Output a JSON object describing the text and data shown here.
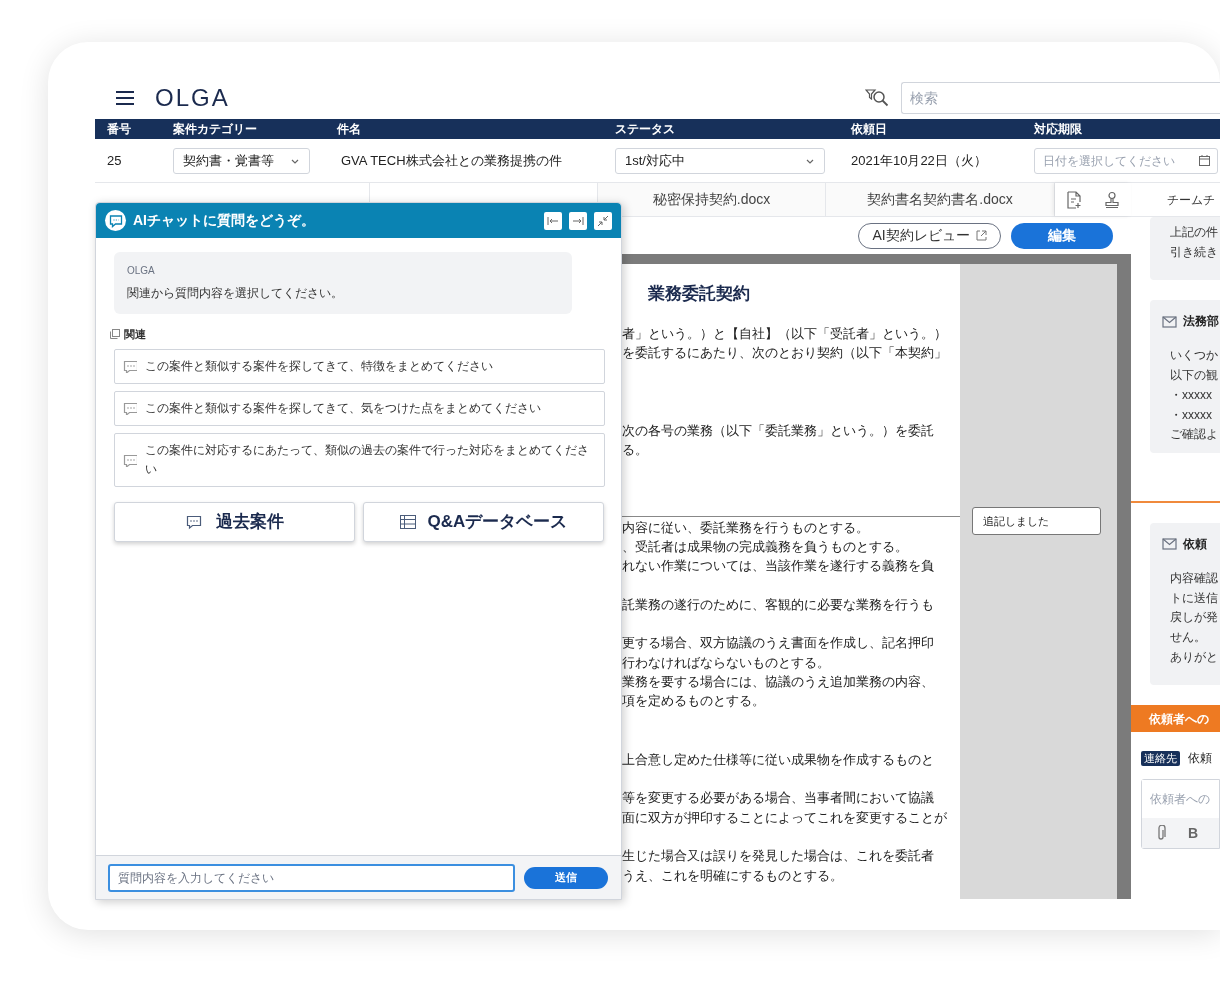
{
  "header": {
    "logo": "OLGA",
    "search": {
      "placeholder": "検索"
    }
  },
  "case_table": {
    "columns": [
      "番号",
      "案件カテゴリー",
      "件名",
      "ステータス",
      "依頼日",
      "対応期限"
    ],
    "row": {
      "number": "25",
      "category": "契約書・覚書等",
      "subject": "GVA TECH株式会社との業務提携の件",
      "status": "1st/対応中",
      "request_date": "2021年10月22日（火）",
      "deadline": {
        "placeholder": "日付を選択してください"
      }
    }
  },
  "document_tabs": [
    {
      "label": "秘密保持契約.docx",
      "selected": false
    },
    {
      "label": "契約書名契約書名.docx",
      "selected": false
    }
  ],
  "doc_toolbar": {
    "review_button": "AI契約レビュー",
    "edit_button": "編集"
  },
  "document": {
    "title": "業務委託契約",
    "paragraphs": [
      [
        "者」という。）と【自社】（以下「受託者」という。）",
        "を委託するにあたり、次のとおり契約（以下「本契約」"
      ],
      [
        "次の各号の業務（以下「委託業務」という。）を委託",
        "る。"
      ],
      [
        "内容に従い、委託業務を行うものとする。",
        "、受託者は成果物の完成義務を負うものとする。",
        "れない作業については、当該作業を遂行する義務を負"
      ],
      [
        "託業務の遂行のために、客観的に必要な業務を行うも"
      ],
      [
        "更する場合、双方協議のうえ書面を作成し、記名押印",
        "行わなければならないものとする。",
        "業務を要する場合には、協議のうえ追加業務の内容、",
        "項を定めるものとする。"
      ],
      [
        "上合意し定めた仕様等に従い成果物を作成するものと"
      ],
      [
        "等を変更する必要がある場合、当事者間において協議",
        "面に双方が押印することによってこれを変更することが"
      ],
      [
        "生じた場合又は誤りを発見した場合は、これを委託者",
        "うえ、これを明確にするものとする。"
      ]
    ],
    "comments": [
      {
        "text": "追記しました"
      }
    ]
  },
  "team_panel": {
    "title": "チームチ",
    "messages": [
      {
        "unread": false,
        "lines": [
          "上記の件",
          "引き続き"
        ]
      },
      {
        "unread": false,
        "title": "法務部",
        "lines": [
          "いくつか",
          "以下の観",
          "・xxxxx",
          "・xxxxx",
          "ご確認よ"
        ]
      },
      {
        "unread": true,
        "title": "依頼",
        "lines": [
          "内容確認",
          "トに送信",
          "戻しが発",
          "せん。",
          "ありがと"
        ]
      }
    ],
    "request_bar": "依頼者への",
    "contact_badge": "連絡先",
    "contact_name": "依頼",
    "message_field": {
      "placeholder": "依頼者への"
    },
    "bold_button": "B"
  },
  "chat": {
    "title": "AIチャットに質問をどうぞ。",
    "message": {
      "sender": "OLGA",
      "text": "関連から質問内容を選択してください。"
    },
    "related_label": "関連",
    "suggestions": [
      "この案件と類似する案件を探してきて、特徴をまとめてください",
      "この案件と類似する案件を探してきて、気をつけた点をまとめてください",
      "この案件に対応するにあたって、類似の過去の案件で行った対応をまとめてください"
    ],
    "actions": [
      {
        "kind": "cases",
        "label": "過去案件"
      },
      {
        "kind": "database",
        "label": "Q&Aデータベース"
      }
    ],
    "input": {
      "placeholder": "質問内容を入力してください",
      "focused": true
    },
    "send_button": "送信"
  }
}
